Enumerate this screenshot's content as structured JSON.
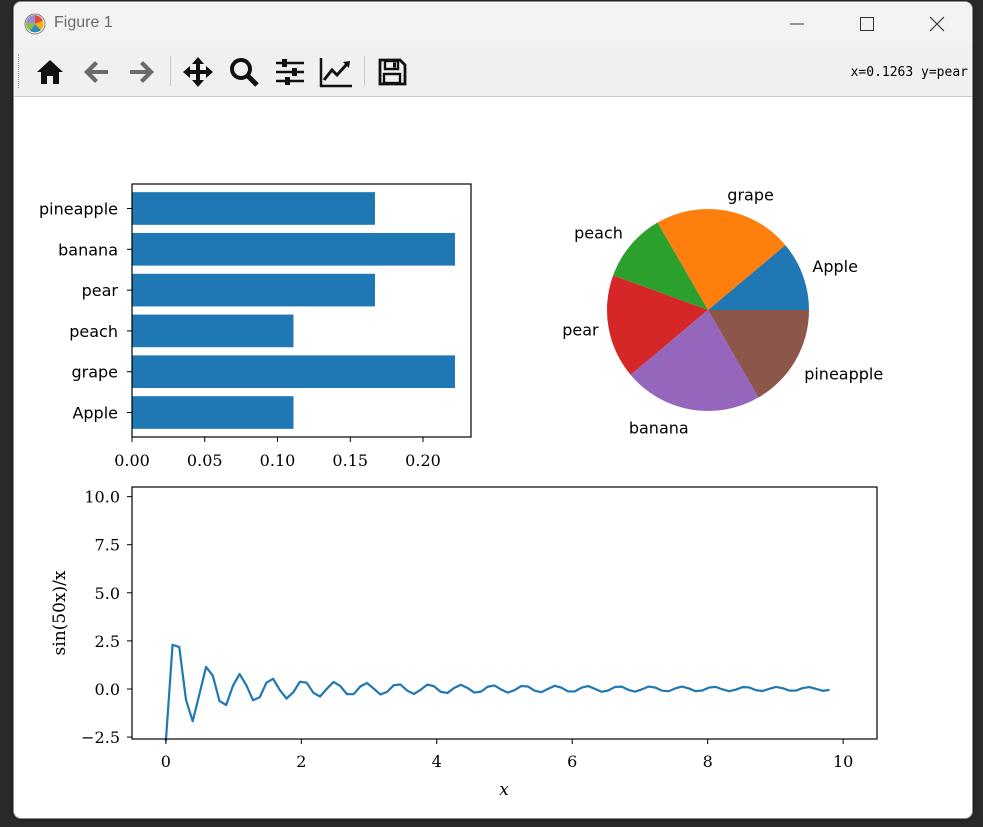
{
  "window": {
    "title": "Figure 1"
  },
  "toolbar": {
    "coords_label": "x=0.1263 y=pear",
    "buttons": [
      "home",
      "back",
      "forward",
      "pan",
      "zoom",
      "configure-subplots",
      "edit-axes",
      "save"
    ]
  },
  "colors": {
    "bar": "#1f77b4",
    "line": "#1f77b4",
    "pie": [
      "#1f77b4",
      "#ff7f0e",
      "#2ca02c",
      "#d62728",
      "#9467bd",
      "#8c564b"
    ]
  },
  "chart_data": [
    {
      "type": "bar",
      "orientation": "horizontal",
      "categories": [
        "Apple",
        "grape",
        "peach",
        "pear",
        "banana",
        "pineapple"
      ],
      "values": [
        0.111,
        0.222,
        0.111,
        0.167,
        0.222,
        0.167
      ],
      "xlim": [
        0,
        0.233
      ],
      "xticks": [
        "0.00",
        "0.05",
        "0.10",
        "0.15",
        "0.20"
      ],
      "xtick_values": [
        0,
        0.05,
        0.1,
        0.15,
        0.2
      ]
    },
    {
      "type": "pie",
      "labels": [
        "Apple",
        "grape",
        "peach",
        "pear",
        "banana",
        "pineapple"
      ],
      "values": [
        2,
        4,
        2,
        3,
        4,
        3
      ]
    },
    {
      "type": "line",
      "function": "sin(50x)/x",
      "x_range": [
        0.2,
        10.0
      ],
      "xlabel": "x",
      "ylabel": "sin(50x)/x",
      "xlim": [
        -0.5,
        10.5
      ],
      "ylim": [
        -2.6,
        10.5
      ],
      "xticks": [
        "0",
        "2",
        "4",
        "6",
        "8",
        "10"
      ],
      "xtick_values": [
        0,
        2,
        4,
        6,
        8,
        10
      ],
      "yticks": [
        "−2.5",
        "0.0",
        "2.5",
        "5.0",
        "7.5",
        "10.0"
      ],
      "ytick_values": [
        -2.5,
        0,
        2.5,
        5,
        7.5,
        10
      ]
    }
  ]
}
